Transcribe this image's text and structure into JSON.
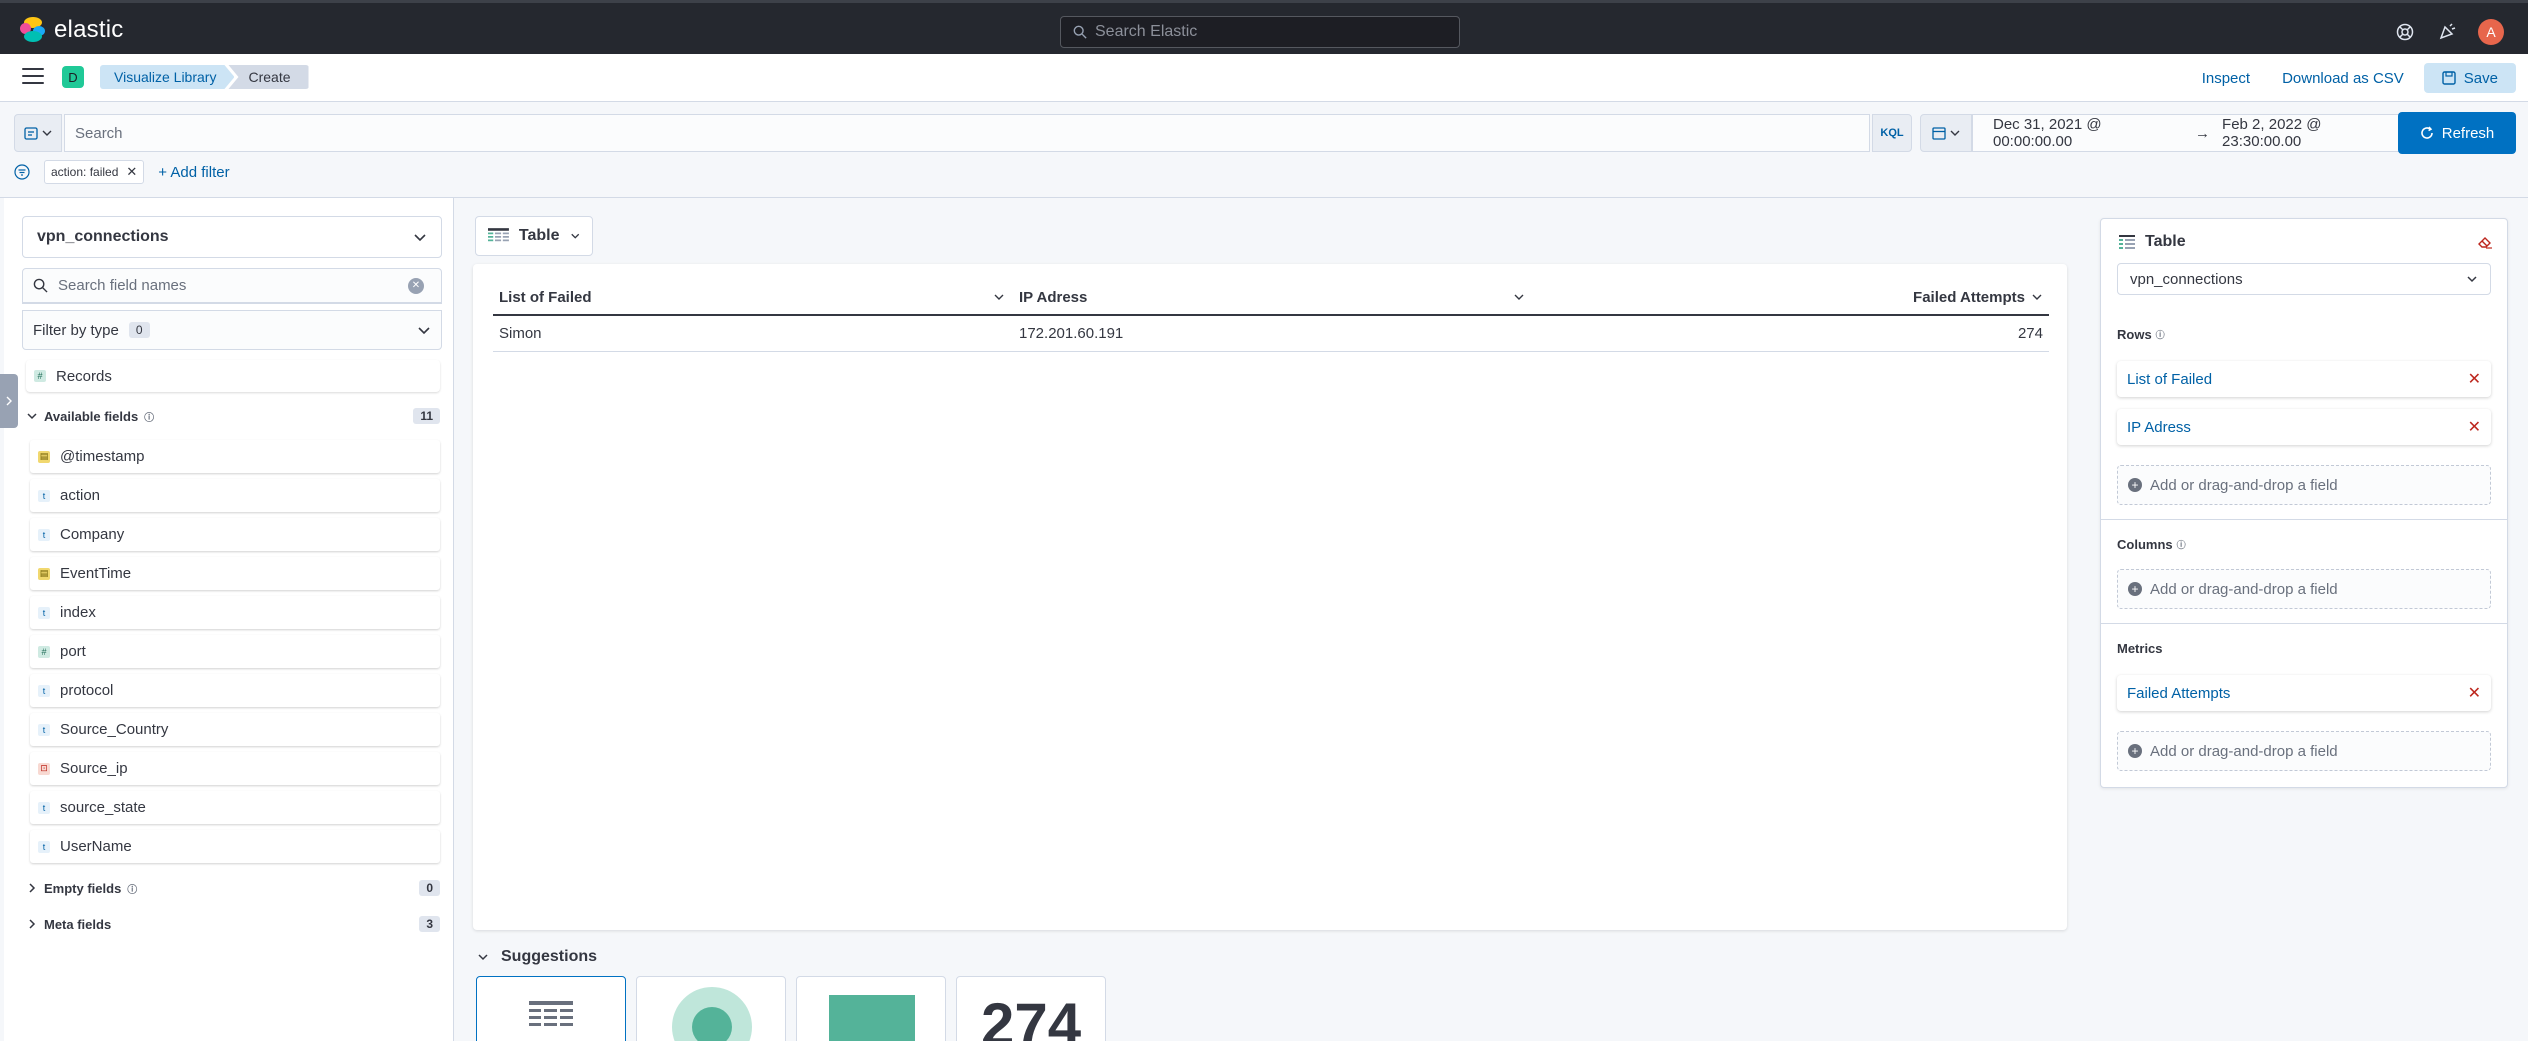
{
  "app": {
    "name": "elastic"
  },
  "header": {
    "search_placeholder": "Search Elastic",
    "avatar_initial": "A",
    "space_initial": "D"
  },
  "nav": {
    "breadcrumbs": [
      "Visualize Library",
      "Create"
    ],
    "inspect": "Inspect",
    "download_csv": "Download as CSV",
    "save": "Save"
  },
  "query": {
    "placeholder": "Search",
    "language": "KQL",
    "date_start": "Dec 31, 2021 @ 00:00:00.00",
    "date_arrow": "→",
    "date_end": "Feb 2, 2022 @ 23:30:00.00",
    "refresh": "Refresh",
    "filter_pill": "action: failed",
    "add_filter": "+ Add filter"
  },
  "sidebar": {
    "index_pattern": "vpn_connections",
    "field_search_placeholder": "Search field names",
    "filter_by_type": "Filter by type",
    "filter_by_type_count": "0",
    "records_label": "Records",
    "available_fields_label": "Available fields",
    "available_fields_count": "11",
    "fields": [
      {
        "name": "@timestamp",
        "type": "date"
      },
      {
        "name": "action",
        "type": "string"
      },
      {
        "name": "Company",
        "type": "string"
      },
      {
        "name": "EventTime",
        "type": "date"
      },
      {
        "name": "index",
        "type": "string"
      },
      {
        "name": "port",
        "type": "number"
      },
      {
        "name": "protocol",
        "type": "string"
      },
      {
        "name": "Source_Country",
        "type": "string"
      },
      {
        "name": "Source_ip",
        "type": "ip"
      },
      {
        "name": "source_state",
        "type": "string"
      },
      {
        "name": "UserName",
        "type": "string"
      }
    ],
    "empty_fields_label": "Empty fields",
    "empty_fields_count": "0",
    "meta_fields_label": "Meta fields",
    "meta_fields_count": "3"
  },
  "workspace": {
    "chart_type": "Table",
    "table": {
      "headers": [
        "List of Failed",
        "IP Adress",
        "Failed Attempts"
      ],
      "rows": [
        [
          "Simon",
          "172.201.60.191",
          "274"
        ]
      ]
    },
    "suggestions_label": "Suggestions",
    "suggestion_metric_value": "274"
  },
  "config_panel": {
    "title": "Table",
    "index_pattern": "vpn_connections",
    "rows_label": "Rows",
    "rows": [
      "List of Failed",
      "IP Adress"
    ],
    "columns_label": "Columns",
    "metrics_label": "Metrics",
    "metrics": [
      "Failed Attempts"
    ],
    "add_field": "Add or drag-and-drop a field"
  },
  "colors": {
    "topbar": "#25282f",
    "accent": "#0071c2",
    "link": "#0061a6",
    "danger": "#bd271e",
    "suggestion_green": "#54b399"
  }
}
